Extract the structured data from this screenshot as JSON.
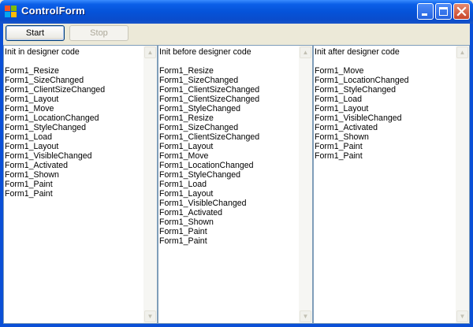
{
  "window": {
    "title": "ControlForm"
  },
  "toolbar": {
    "start_label": "Start",
    "stop_label": "Stop"
  },
  "panels": [
    {
      "lines": [
        "Init in designer code",
        "",
        "Form1_Resize",
        "Form1_SizeChanged",
        "Form1_ClientSizeChanged",
        "Form1_Layout",
        "Form1_Move",
        "Form1_LocationChanged",
        "Form1_StyleChanged",
        "Form1_Load",
        "Form1_Layout",
        "Form1_VisibleChanged",
        "Form1_Activated",
        "Form1_Shown",
        "Form1_Paint",
        "Form1_Paint"
      ]
    },
    {
      "lines": [
        "Init before designer code",
        "",
        "Form1_Resize",
        "Form1_SizeChanged",
        "Form1_ClientSizeChanged",
        "Form1_ClientSizeChanged",
        "Form1_StyleChanged",
        "Form1_Resize",
        "Form1_SizeChanged",
        "Form1_ClientSizeChanged",
        "Form1_Layout",
        "Form1_Move",
        "Form1_LocationChanged",
        "Form1_StyleChanged",
        "Form1_Load",
        "Form1_Layout",
        "Form1_VisibleChanged",
        "Form1_Activated",
        "Form1_Shown",
        "Form1_Paint",
        "Form1_Paint"
      ]
    },
    {
      "lines": [
        "Init after designer code",
        "",
        "Form1_Move",
        "Form1_LocationChanged",
        "Form1_StyleChanged",
        "Form1_Load",
        "Form1_Layout",
        "Form1_VisibleChanged",
        "Form1_Activated",
        "Form1_Shown",
        "Form1_Paint",
        "Form1_Paint"
      ]
    }
  ],
  "icons": {
    "app": "windows-form-icon",
    "minimize": "minimize-icon",
    "maximize": "maximize-icon",
    "close": "close-icon",
    "scroll_up": "chevron-up-icon",
    "scroll_down": "chevron-down-icon"
  },
  "colors": {
    "titlebar": "#0553D9",
    "close_button": "#C8452A",
    "face": "#ECE9D8",
    "panel_border": "#7F9DB9"
  }
}
